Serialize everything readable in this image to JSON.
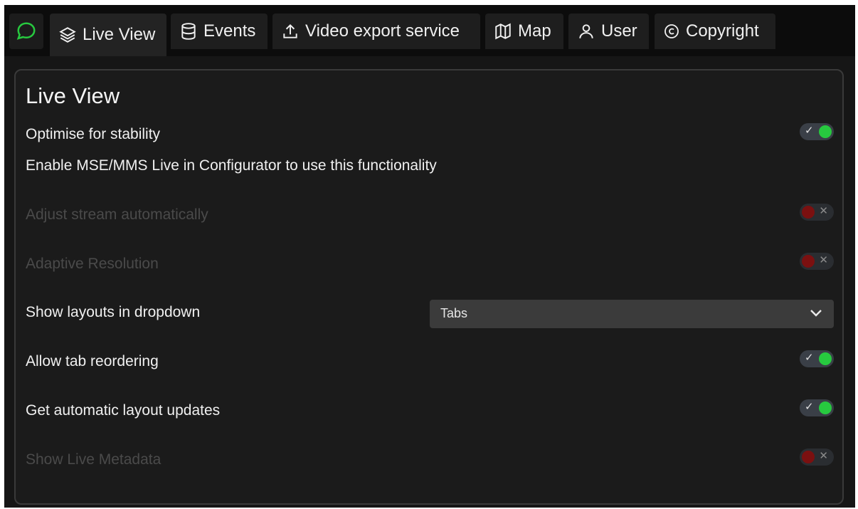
{
  "tabs": [
    {
      "label": "Live View",
      "icon": "layers-icon",
      "active": true
    },
    {
      "label": "Events",
      "icon": "database-icon"
    },
    {
      "label": "Video export service",
      "icon": "upload-icon"
    },
    {
      "label": "Map",
      "icon": "map-icon"
    },
    {
      "label": "User",
      "icon": "user-icon"
    },
    {
      "label": "Copyright",
      "icon": "copyright-icon"
    }
  ],
  "colors": {
    "accent_on": "#27c93f",
    "accent_off": "#7b1010",
    "background": "#161616"
  },
  "panel": {
    "title": "Live View",
    "settings": [
      {
        "label": "Optimise for stability",
        "control": "toggle",
        "state": "on",
        "enabled": true
      },
      {
        "label": "Enable MSE/MMS Live in Configurator to use this functionality",
        "control": "none",
        "enabled": true
      },
      {
        "label": "Adjust stream automatically",
        "control": "toggle",
        "state": "off",
        "enabled": false
      },
      {
        "label": "Adaptive Resolution",
        "control": "toggle",
        "state": "off",
        "enabled": false
      },
      {
        "label": "Show layouts in dropdown",
        "control": "select",
        "value": "Tabs",
        "enabled": true
      },
      {
        "label": "Allow tab reordering",
        "control": "toggle",
        "state": "on",
        "enabled": true
      },
      {
        "label": "Get automatic layout updates",
        "control": "toggle",
        "state": "on",
        "enabled": true
      },
      {
        "label": "Show Live Metadata",
        "control": "toggle",
        "state": "off",
        "enabled": false
      }
    ]
  },
  "toggle_marks": {
    "on": "✓",
    "off": "✕"
  }
}
